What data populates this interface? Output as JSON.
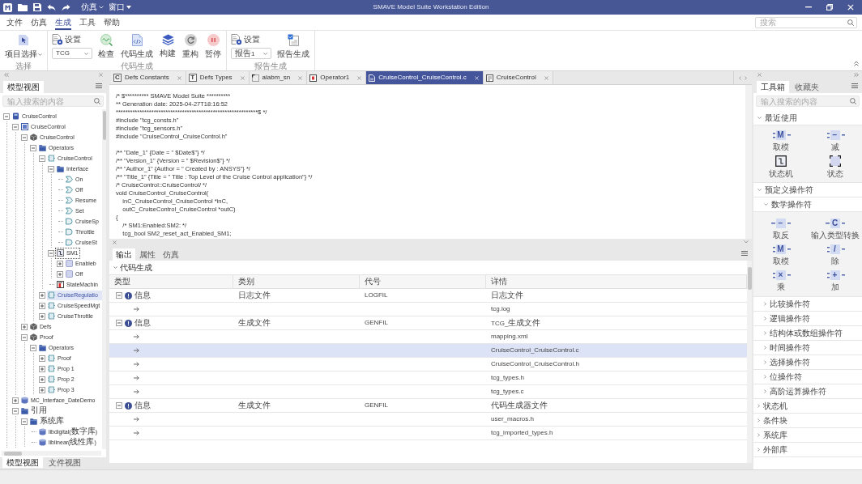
{
  "title_bar": {
    "quick_menus": [
      {
        "label": "仿真"
      },
      {
        "label": "窗口"
      }
    ],
    "title": "SMAVE Model Suite Workstation Edition"
  },
  "menu_bar": {
    "items": [
      {
        "label": "文件",
        "selected": false
      },
      {
        "label": "仿真",
        "selected": false
      },
      {
        "label": "生成",
        "selected": true
      },
      {
        "label": "工具",
        "selected": false
      },
      {
        "label": "帮助",
        "selected": false
      }
    ],
    "search": {
      "placeholder": "搜索"
    }
  },
  "ribbon": {
    "groups": [
      {
        "label": "选择",
        "items": [
          {
            "kind": "menu_button",
            "label": "项目选择"
          }
        ]
      },
      {
        "label": "代码生成",
        "items": [
          {
            "kind": "settings",
            "label": "设置",
            "value": "TCG"
          },
          {
            "kind": "button",
            "label": "检查"
          },
          {
            "kind": "button",
            "label": "代码生成"
          },
          {
            "kind": "button",
            "label": "构建"
          },
          {
            "kind": "button",
            "label": "重构"
          },
          {
            "kind": "button",
            "label": "暂停"
          }
        ]
      },
      {
        "label": "报告生成",
        "items": [
          {
            "kind": "settings",
            "label": "设置",
            "value": "报告1"
          },
          {
            "kind": "button",
            "label": "报告生成"
          }
        ]
      }
    ]
  },
  "model_panel": {
    "tabs": [
      {
        "label": "模型视图",
        "selected": true
      }
    ],
    "search": {
      "placeholder": "输入搜索的内容"
    },
    "tree": [
      {
        "kind": "project",
        "label": "CruiseControl",
        "expanded": true,
        "selected": false,
        "focused": false,
        "children": [
          {
            "kind": "model",
            "label": "CruiseControl",
            "expanded": true,
            "selected": false,
            "focused": false,
            "children": [
              {
                "kind": "package",
                "label": "CruiseControl",
                "expanded": true,
                "selected": false,
                "focused": false,
                "children": [
                  {
                    "kind": "folder",
                    "label": "Operators",
                    "expanded": true,
                    "selected": false,
                    "focused": false,
                    "children": [
                      {
                        "kind": "operator",
                        "label": "CruiseControl",
                        "expanded": true,
                        "selected": false,
                        "focused": false,
                        "children": [
                          {
                            "kind": "folder",
                            "label": "Interface",
                            "expanded": true,
                            "selected": false,
                            "focused": false,
                            "children": [
                              {
                                "kind": "input",
                                "label": "On",
                                "selected": false,
                                "focused": false
                              },
                              {
                                "kind": "input",
                                "label": "Off",
                                "selected": false,
                                "focused": false
                              },
                              {
                                "kind": "input",
                                "label": "Resume",
                                "selected": false,
                                "focused": false
                              },
                              {
                                "kind": "input",
                                "label": "Set",
                                "selected": false,
                                "focused": false
                              },
                              {
                                "kind": "output",
                                "label": "CruiseSp",
                                "selected": false,
                                "focused": false
                              },
                              {
                                "kind": "output",
                                "label": "Throttle",
                                "selected": false,
                                "focused": false
                              },
                              {
                                "kind": "output",
                                "label": "CruiseSt",
                                "selected": false,
                                "focused": false
                              }
                            ]
                          },
                          {
                            "kind": "state_machine",
                            "label": "SM1",
                            "expanded": true,
                            "selected": false,
                            "focused": true,
                            "children": [
                              {
                                "kind": "state",
                                "label": "Enableb",
                                "expanded": false,
                                "selected": false,
                                "focused": false
                              },
                              {
                                "kind": "state",
                                "label": "Off",
                                "expanded": false,
                                "selected": false,
                                "focused": false
                              }
                            ]
                          },
                          {
                            "kind": "diagram",
                            "label": "StateMachin",
                            "selected": false,
                            "focused": false
                          }
                        ]
                      },
                      {
                        "kind": "operator",
                        "label": "CruiseRegulatio",
                        "expanded": false,
                        "selected": true,
                        "focused": false
                      },
                      {
                        "kind": "operator",
                        "label": "CruiseSpeedMgt",
                        "expanded": false,
                        "selected": false,
                        "focused": false
                      },
                      {
                        "kind": "operator",
                        "label": "CruiseThrottle",
                        "expanded": false,
                        "selected": false,
                        "focused": false
                      }
                    ]
                  }
                ]
              },
              {
                "kind": "package",
                "label": "Defs",
                "expanded": false,
                "selected": false,
                "focused": false
              },
              {
                "kind": "package",
                "label": "Proof",
                "expanded": true,
                "selected": false,
                "focused": false,
                "children": [
                  {
                    "kind": "folder",
                    "label": "Operators",
                    "expanded": true,
                    "selected": false,
                    "focused": false,
                    "children": [
                      {
                        "kind": "operator",
                        "label": "Proof",
                        "expanded": false,
                        "selected": false,
                        "focused": false
                      },
                      {
                        "kind": "operator",
                        "label": "Prop 1",
                        "expanded": false,
                        "selected": false,
                        "focused": false
                      },
                      {
                        "kind": "operator",
                        "label": "Prop 2",
                        "expanded": false,
                        "selected": false,
                        "focused": false
                      },
                      {
                        "kind": "operator",
                        "label": "Prop 3",
                        "expanded": false,
                        "selected": false,
                        "focused": false
                      }
                    ]
                  }
                ]
              }
            ]
          },
          {
            "kind": "library",
            "label": "MC_Interface_DateDemo",
            "expanded": false,
            "selected": false,
            "focused": false
          },
          {
            "kind": "folder",
            "label": "引用",
            "expanded": true,
            "selected": false,
            "focused": false,
            "children": [
              {
                "kind": "folder",
                "label": "系统库",
                "expanded": true,
                "selected": false,
                "focused": false,
                "children": [
                  {
                    "kind": "library",
                    "label": "libdigital(数字库)",
                    "selected": false,
                    "focused": false
                  },
                  {
                    "kind": "library",
                    "label": "liblinear(线性库)",
                    "selected": false,
                    "focused": false
                  }
                ]
              }
            ]
          }
        ]
      }
    ],
    "bottom_tabs": [
      {
        "label": "模型视图",
        "selected": true
      },
      {
        "label": "文件视图",
        "selected": false
      }
    ]
  },
  "editor": {
    "tabs": [
      {
        "kind": "constants",
        "badge": "C",
        "label": "Defs Constants",
        "selected": false
      },
      {
        "kind": "types",
        "badge": "T",
        "label": "Defs Types",
        "selected": false
      },
      {
        "kind": "diagram",
        "label": "alabm_sn",
        "selected": false
      },
      {
        "kind": "operator",
        "label": "Operator1",
        "selected": false
      },
      {
        "kind": "source",
        "label": "CruiseControl_CruiseControl.c",
        "selected": true
      },
      {
        "kind": "model",
        "label": "CruiseControl",
        "selected": false
      }
    ],
    "code_blocks": [
      [
        "/* $********** SMAVE Model Suite **********",
        "** Generation date: 2025-04-27T18:16:52",
        "************************************************************$ */",
        "#include \"tcg_consts.h\"",
        "#include \"tcg_sensors.h\"",
        "#include \"CruiseControl_CruiseControl.h\""
      ],
      [
        "/** \"Date_1\" {Date = \" $Date$\"} */",
        "/** \"Version_1\" {Version = \" $Revision$\"} */",
        "/** \"Author_1\" {Author = \" Created by : ANSYS\"} */",
        "/** \"Title_1\" {Title = \" Title : Top Level of the Cruise Control application\"} */",
        "/* CruiseControl::CruiseControl/ */",
        "void CruiseControl_CruiseControl(",
        "    inC_CruiseControl_CruiseControl *inC,",
        "    outC_CruiseControl_CruiseControl *outC)",
        "{",
        "    /* SM1:Enabled:SM2: */",
        "    tcg_bool SM2_reset_act_Enabled_SM1;"
      ]
    ]
  },
  "output_panel": {
    "tabs": [
      {
        "label": "输出",
        "selected": true
      },
      {
        "label": "属性",
        "selected": false
      },
      {
        "label": "仿真",
        "selected": false
      }
    ],
    "group": {
      "label": "代码生成",
      "expanded": true
    },
    "columns": [
      "类型",
      "类别",
      "代号",
      "详情"
    ],
    "rows": [
      {
        "type": "信息",
        "category": "日志文件",
        "code": "LOGFIL",
        "detail": "日志文件",
        "expanded": true,
        "selected": false,
        "children": [
          {
            "detail": "tcg.log",
            "selected": false
          }
        ]
      },
      {
        "type": "信息",
        "category": "生成文件",
        "code": "GENFIL",
        "detail": "TCG_生成文件",
        "expanded": true,
        "selected": false,
        "children": [
          {
            "detail": "mapping.xml",
            "selected": false
          },
          {
            "detail": "CruiseControl_CruiseControl.c",
            "selected": true
          },
          {
            "detail": "CruiseControl_CruiseControl.h",
            "selected": false
          },
          {
            "detail": "tcg_types.h",
            "selected": false
          },
          {
            "detail": "tcg_types.c",
            "selected": false
          }
        ]
      },
      {
        "type": "信息",
        "category": "生成文件",
        "code": "GENFIL",
        "detail": "代码生成器文件",
        "expanded": true,
        "selected": false,
        "children": [
          {
            "detail": "user_macros.h",
            "selected": false
          },
          {
            "detail": "tcg_imported_types.h",
            "selected": false
          }
        ]
      }
    ]
  },
  "toolbox": {
    "tabs": [
      {
        "label": "工具箱",
        "selected": true
      },
      {
        "label": "收藏夹",
        "selected": false
      }
    ],
    "search": {
      "placeholder": "输入搜索的内容"
    },
    "sections": [
      {
        "label": "最近使用",
        "expanded": true,
        "items": [
          {
            "kind": "binary_operator",
            "symbol": "M",
            "label": "取模"
          },
          {
            "kind": "binary_operator",
            "symbol": "−",
            "label": "减"
          },
          {
            "kind": "state_machine",
            "label": "状态机"
          },
          {
            "kind": "state",
            "label": "状态"
          }
        ]
      },
      {
        "label": "预定义操作符",
        "expanded": true,
        "groups": [
          {
            "label": "数学操作符",
            "expanded": true,
            "items": [
              {
                "kind": "unary_operator",
                "symbol": "−",
                "label": "取反"
              },
              {
                "kind": "unary_operator",
                "symbol": "C",
                "label": "输入类型转换"
              },
              {
                "kind": "binary_operator",
                "symbol": "M",
                "label": "取模"
              },
              {
                "kind": "binary_operator",
                "symbol": "/",
                "label": "除"
              },
              {
                "kind": "binary_operator",
                "symbol": "×",
                "label": "乘"
              },
              {
                "kind": "binary_operator",
                "symbol": "+",
                "label": "加"
              }
            ]
          },
          {
            "label": "比较操作符",
            "expanded": false
          },
          {
            "label": "逻辑操作符",
            "expanded": false
          },
          {
            "label": "结构体或数组操作符",
            "expanded": false
          },
          {
            "label": "时间操作符",
            "expanded": false
          },
          {
            "label": "选择操作符",
            "expanded": false
          },
          {
            "label": "位操作符",
            "expanded": false
          },
          {
            "label": "高阶运算操作符",
            "expanded": false
          }
        ]
      },
      {
        "label": "状态机",
        "expanded": false
      },
      {
        "label": "条件块",
        "expanded": false
      },
      {
        "label": "系统库",
        "expanded": false
      },
      {
        "label": "外部库",
        "expanded": false
      }
    ]
  }
}
